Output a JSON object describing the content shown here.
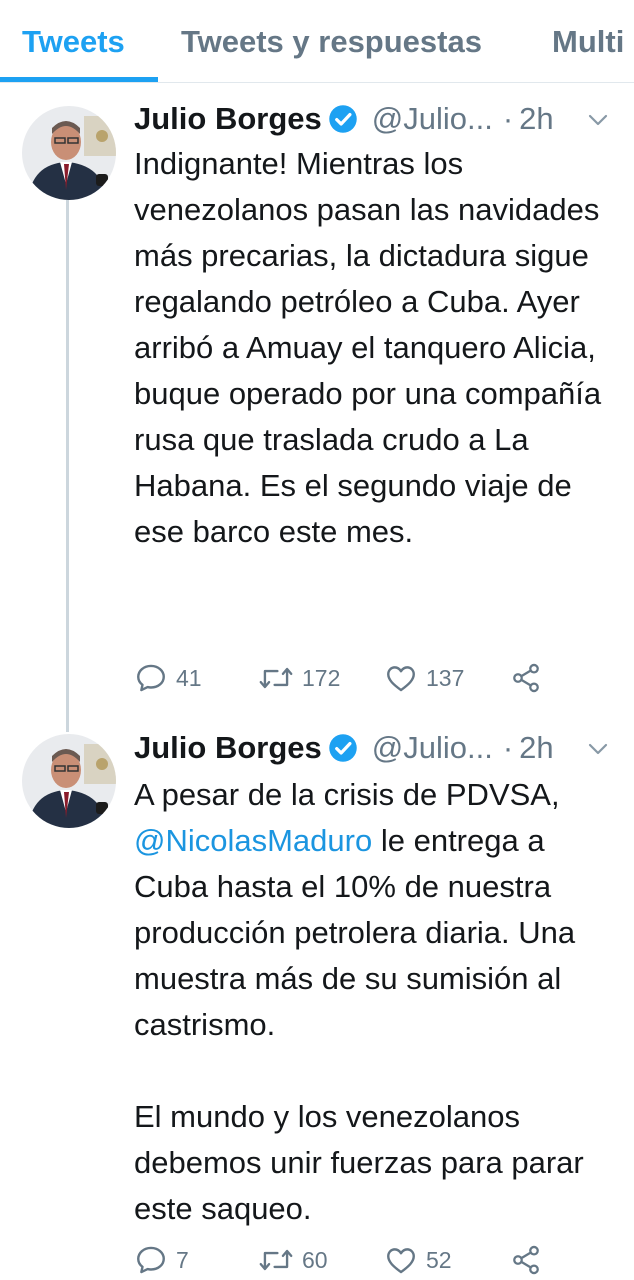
{
  "tabs": [
    {
      "label": "Tweets",
      "active": true
    },
    {
      "label": "Tweets y respuestas",
      "active": false
    },
    {
      "label": "Multi",
      "active": false
    }
  ],
  "colors": {
    "accent": "#1da1f2",
    "link": "#1b95e0",
    "secondary_text": "#657786",
    "divider": "#e1e8ed"
  },
  "tweets": [
    {
      "author": "Julio Borges",
      "handle": "@Julio...",
      "separator": "·",
      "time": "2h",
      "verified": true,
      "text": "Indignante! Mientras los venezolanos pasan las navidades más precarias, la dictadura sigue regalando petróleo a Cuba. Ayer arribó a Amuay el tanquero Alicia, buque operado por una compañía rusa que traslada crudo a La Habana. Es el segundo viaje de ese barco este mes.",
      "replies": "41",
      "retweets": "172",
      "likes": "137"
    },
    {
      "author": "Julio Borges",
      "handle": "@Julio...",
      "separator": "·",
      "time": "2h",
      "verified": true,
      "text_before": "A pesar de la crisis de PDVSA,",
      "mention": "@NicolasMaduro",
      "text_after": " le entrega a Cuba hasta el 10% de nuestra producción petrolera diaria. Una muestra más de su sumisión al castrismo.\n\nEl mundo y los venezolanos debemos unir fuerzas para parar este saqueo.",
      "replies": "7",
      "retweets": "60",
      "likes": "52"
    }
  ],
  "icons": {
    "reply": "reply-icon",
    "retweet": "retweet-icon",
    "like": "heart-icon",
    "share": "share-icon",
    "verified": "verified-badge-icon",
    "menu": "chevron-down-icon"
  }
}
